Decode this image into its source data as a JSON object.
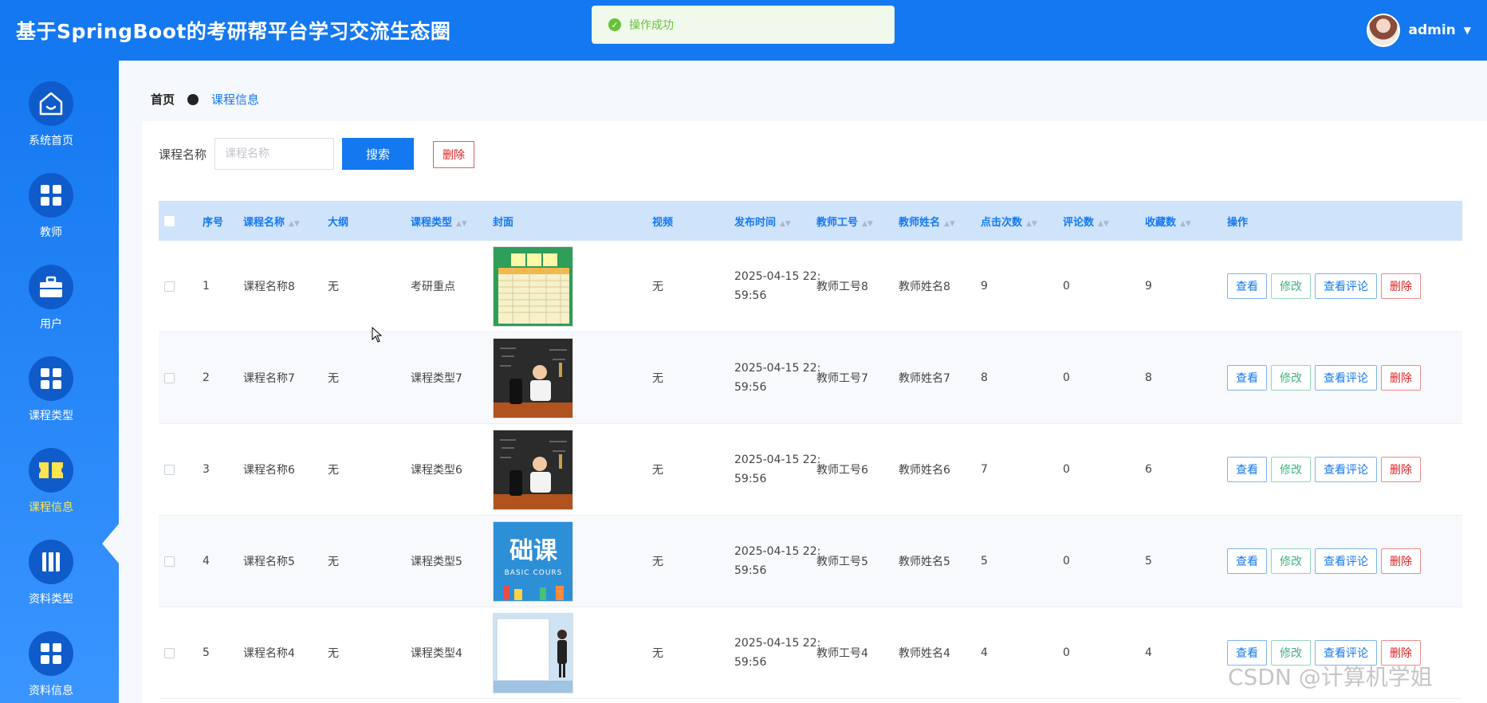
{
  "header": {
    "title": "基于SpringBoot的考研帮平台学习交流生态圈",
    "user_name": "admin"
  },
  "toast": {
    "message": "操作成功"
  },
  "sidebar": {
    "items": [
      {
        "label": "系统首页",
        "icon": "home-icon"
      },
      {
        "label": "教师",
        "icon": "grid-icon"
      },
      {
        "label": "用户",
        "icon": "briefcase-icon"
      },
      {
        "label": "课程类型",
        "icon": "grid-icon"
      },
      {
        "label": "课程信息",
        "icon": "ticket-icon",
        "active": true
      },
      {
        "label": "资料类型",
        "icon": "book-icon"
      },
      {
        "label": "资料信息",
        "icon": "grid-icon"
      }
    ],
    "active_color": "#ffe44d"
  },
  "breadcrumb": {
    "home": "首页",
    "current": "课程信息"
  },
  "search": {
    "label": "课程名称",
    "placeholder": "课程名称",
    "button": "搜索",
    "delete_button": "删除"
  },
  "table": {
    "headers": {
      "index": "序号",
      "name": "课程名称",
      "outline": "大纲",
      "type": "课程类型",
      "cover": "封面",
      "video": "视频",
      "publish_time": "发布时间",
      "teacher_id": "教师工号",
      "teacher_name": "教师姓名",
      "clicks": "点击次数",
      "comments": "评论数",
      "favorites": "收藏数",
      "actions": "操作"
    },
    "actions": {
      "view": "查看",
      "edit": "修改",
      "view_comments": "查看评论",
      "delete": "删除"
    },
    "rows": [
      {
        "index": "1",
        "name": "课程名称8",
        "outline": "无",
        "type": "考研重点",
        "video": "无",
        "time_a": "2025-04-15 22:",
        "time_b": "59:56",
        "teacher_id": "教师工号8",
        "teacher_name": "教师姓名8",
        "clicks": "9",
        "comments": "0",
        "favorites": "9",
        "cover": "timetable"
      },
      {
        "index": "2",
        "name": "课程名称7",
        "outline": "无",
        "type": "课程类型7",
        "video": "无",
        "time_a": "2025-04-15 22:",
        "time_b": "59:56",
        "teacher_id": "教师工号7",
        "teacher_name": "教师姓名7",
        "clicks": "8",
        "comments": "0",
        "favorites": "8",
        "cover": "classroom"
      },
      {
        "index": "3",
        "name": "课程名称6",
        "outline": "无",
        "type": "课程类型6",
        "video": "无",
        "time_a": "2025-04-15 22:",
        "time_b": "59:56",
        "teacher_id": "教师工号6",
        "teacher_name": "教师姓名6",
        "clicks": "7",
        "comments": "0",
        "favorites": "6",
        "cover": "classroom"
      },
      {
        "index": "4",
        "name": "课程名称5",
        "outline": "无",
        "type": "课程类型5",
        "video": "无",
        "time_a": "2025-04-15 22:",
        "time_b": "59:56",
        "teacher_id": "教师工号5",
        "teacher_name": "教师姓名5",
        "clicks": "5",
        "comments": "0",
        "favorites": "5",
        "cover": "basic",
        "cover_text_a": "础课",
        "cover_text_b": "BASIC COURS"
      },
      {
        "index": "5",
        "name": "课程名称4",
        "outline": "无",
        "type": "课程类型4",
        "video": "无",
        "time_a": "2025-04-15 22:",
        "time_b": "59:56",
        "teacher_id": "教师工号4",
        "teacher_name": "教师姓名4",
        "clicks": "4",
        "comments": "0",
        "favorites": "4",
        "cover": "presenter"
      }
    ]
  },
  "watermark": "CSDN @计算机学姐",
  "colors": {
    "primary": "#1478f0",
    "success": "#67c23a",
    "danger": "#e02020",
    "header_row": "#cfe3fb"
  }
}
